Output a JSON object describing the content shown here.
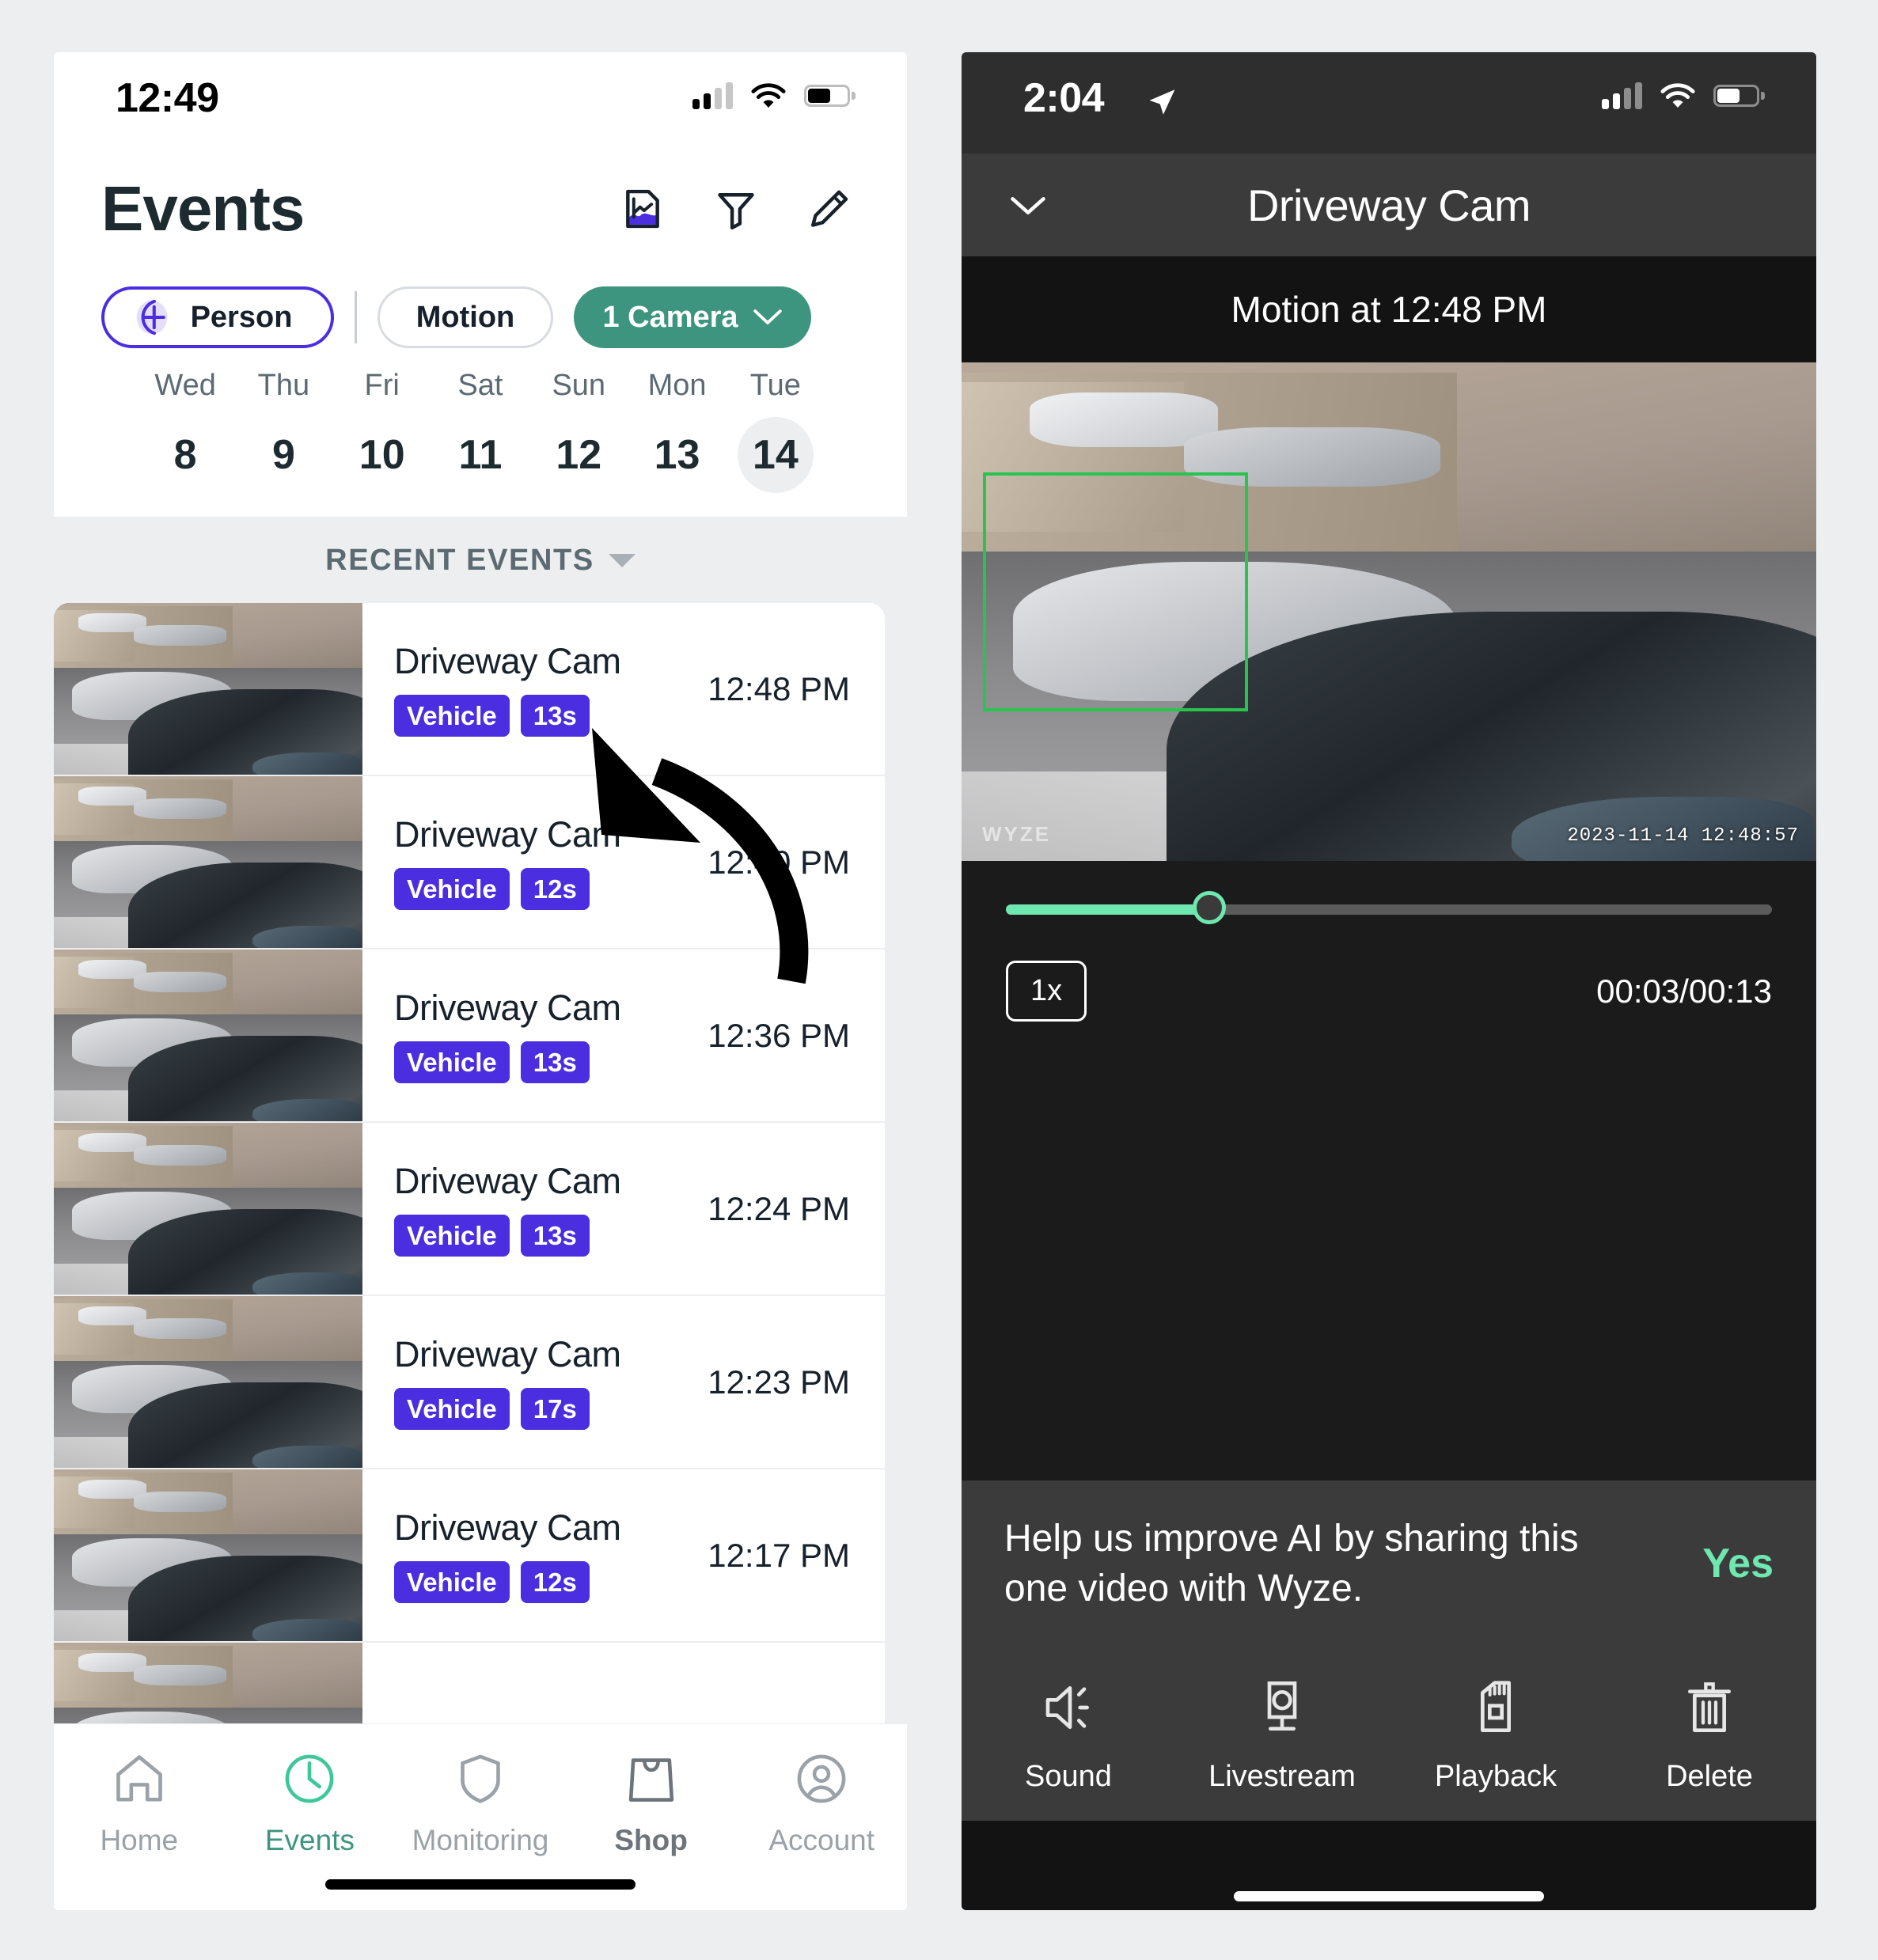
{
  "left_phone": {
    "status": {
      "time": "12:49",
      "battery_icon": "battery-icon",
      "wifi_icon": "wifi-icon",
      "signal_icon": "cellular-signal-icon"
    },
    "header": {
      "title": "Events",
      "icons": [
        {
          "name": "report-chart-icon",
          "label": "Report"
        },
        {
          "name": "filter-funnel-icon",
          "label": "Filter"
        },
        {
          "name": "edit-pencil-icon",
          "label": "Edit"
        }
      ]
    },
    "filters": {
      "person_label": "Person",
      "motion_label": "Motion",
      "camera_label": "1 Camera",
      "camera_caret": "chevron-down-icon",
      "person_accent": "#4b2ee0",
      "camera_accent": "#3e957f"
    },
    "calendar": {
      "days": [
        {
          "dow": "Wed",
          "num": "8",
          "selected": false
        },
        {
          "dow": "Thu",
          "num": "9",
          "selected": false
        },
        {
          "dow": "Fri",
          "num": "10",
          "selected": false
        },
        {
          "dow": "Sat",
          "num": "11",
          "selected": false
        },
        {
          "dow": "Sun",
          "num": "12",
          "selected": false
        },
        {
          "dow": "Mon",
          "num": "13",
          "selected": false
        },
        {
          "dow": "Tue",
          "num": "14",
          "selected": true
        }
      ]
    },
    "list": {
      "section_title": "RECENT EVENTS",
      "sort_caret": "caret-down-icon",
      "events": [
        {
          "camera": "Driveway Cam",
          "tag": "Vehicle",
          "duration": "13s",
          "time": "12:48 PM"
        },
        {
          "camera": "Driveway Cam",
          "tag": "Vehicle",
          "duration": "12s",
          "time": "12:40 PM"
        },
        {
          "camera": "Driveway Cam",
          "tag": "Vehicle",
          "duration": "13s",
          "time": "12:36 PM"
        },
        {
          "camera": "Driveway Cam",
          "tag": "Vehicle",
          "duration": "13s",
          "time": "12:24 PM"
        },
        {
          "camera": "Driveway Cam",
          "tag": "Vehicle",
          "duration": "17s",
          "time": "12:23 PM"
        },
        {
          "camera": "Driveway Cam",
          "tag": "Vehicle",
          "duration": "12s",
          "time": "12:17 PM"
        }
      ],
      "badge_color": "#4b2ee0"
    },
    "tabbar": {
      "tabs": [
        {
          "label": "Home",
          "icon": "house-icon",
          "active": false
        },
        {
          "label": "Events",
          "icon": "clock-icon",
          "active": true
        },
        {
          "label": "Monitoring",
          "icon": "shield-icon",
          "active": false
        },
        {
          "label": "Shop",
          "icon": "shopping-bag-icon",
          "active": false
        },
        {
          "label": "Account",
          "icon": "person-circle-icon",
          "active": false
        }
      ],
      "active_color": "#3e957f"
    }
  },
  "right_phone": {
    "status": {
      "time": "2:04",
      "location_icon": "location-arrow-icon",
      "wifi_icon": "wifi-icon",
      "signal_icon": "cellular-signal-icon",
      "battery_icon": "battery-icon"
    },
    "topbar": {
      "collapse_icon": "chevron-down-icon",
      "title": "Driveway Cam"
    },
    "event_caption": "Motion at 12:48 PM",
    "video": {
      "timestamp_overlay": "2023-11-14  12:48:57",
      "watermark": "WYZE",
      "detection_box_color": "#29c450"
    },
    "player": {
      "progress_percent": 26.5,
      "speed_label": "1x",
      "time_label": "00:03/00:13",
      "accent": "#6ee7b0"
    },
    "promo": {
      "text": "Help us improve AI by sharing this one video with Wyze.",
      "yes_label": "Yes",
      "yes_color": "#6ee7b0"
    },
    "actions": [
      {
        "label": "Sound",
        "icon": "speaker-icon"
      },
      {
        "label": "Livestream",
        "icon": "camera-monitor-icon"
      },
      {
        "label": "Playback",
        "icon": "sd-card-icon"
      },
      {
        "label": "Delete",
        "icon": "trash-icon"
      }
    ]
  },
  "annotation": {
    "arrow": "curved-arrow-annotation",
    "color": "#000000"
  }
}
